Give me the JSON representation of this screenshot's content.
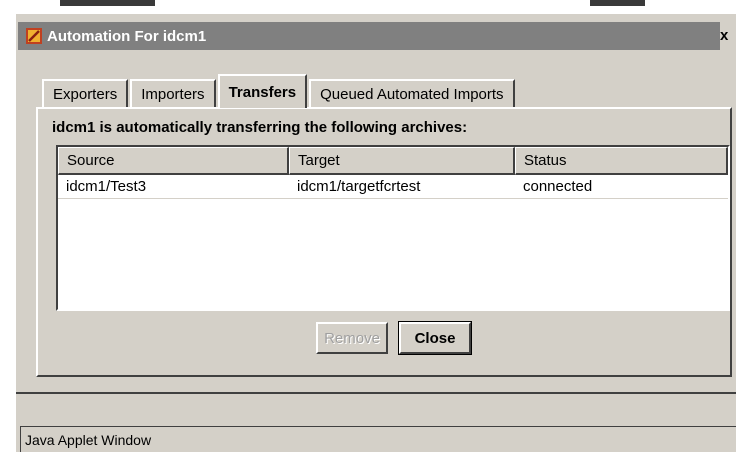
{
  "window": {
    "title": "Automation For idcm1",
    "close_glyph": "x"
  },
  "tabs": [
    {
      "label": "Exporters",
      "active": false
    },
    {
      "label": "Importers",
      "active": false
    },
    {
      "label": "Transfers",
      "active": true
    },
    {
      "label": "Queued Automated Imports",
      "active": false
    }
  ],
  "panel": {
    "heading": "idcm1 is automatically transferring the following archives:",
    "columns": [
      "Source",
      "Target",
      "Status"
    ],
    "rows": [
      {
        "source": "idcm1/Test3",
        "target": "idcm1/targetfcrtest",
        "status": "connected"
      }
    ]
  },
  "buttons": {
    "remove": "Remove",
    "close": "Close"
  },
  "status_bar": {
    "text": "Java Applet Window"
  },
  "colors": {
    "face": "#d4d0c8",
    "titlebar": "#808080",
    "shadow": "#404040",
    "highlight": "#ffffff"
  }
}
